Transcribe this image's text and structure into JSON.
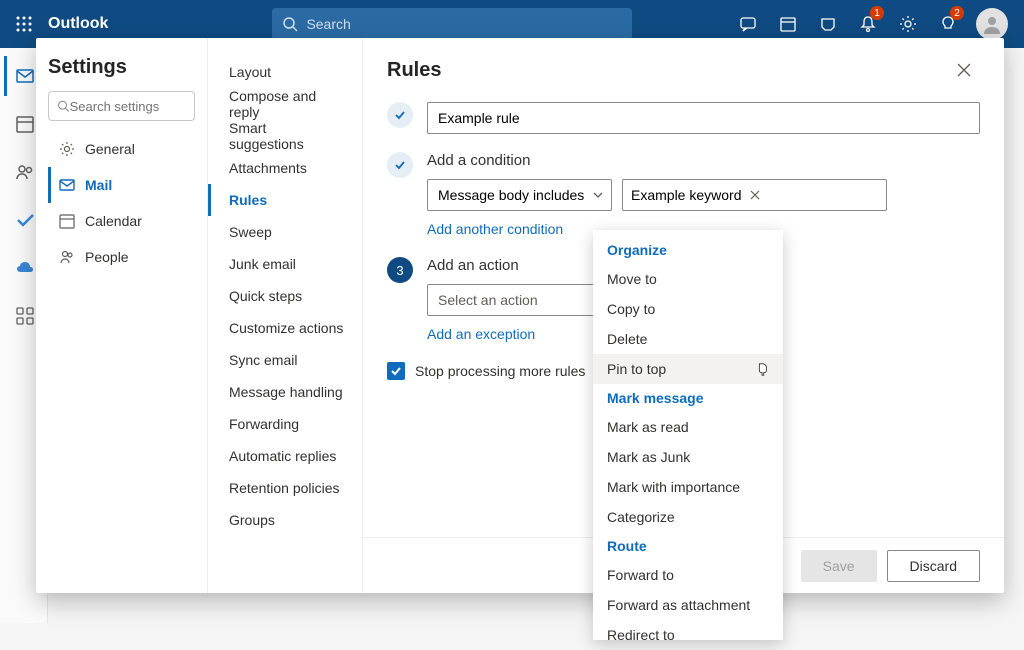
{
  "topbar": {
    "brand": "Outlook",
    "search_placeholder": "Search",
    "notif_badge": "1",
    "help_badge": "2"
  },
  "settings": {
    "title": "Settings",
    "search_placeholder": "Search settings",
    "categories": {
      "general": "General",
      "mail": "Mail",
      "calendar": "Calendar",
      "people": "People"
    },
    "mail_sub": {
      "layout": "Layout",
      "compose": "Compose and reply",
      "smart": "Smart suggestions",
      "attach": "Attachments",
      "rules": "Rules",
      "sweep": "Sweep",
      "junk": "Junk email",
      "quick": "Quick steps",
      "custom": "Customize actions",
      "sync": "Sync email",
      "msgh": "Message handling",
      "fwd": "Forwarding",
      "auto": "Automatic replies",
      "ret": "Retention policies",
      "groups": "Groups"
    }
  },
  "rules": {
    "title": "Rules",
    "name_value": "Example rule",
    "cond_label": "Add a condition",
    "cond_select": "Message body includes",
    "cond_keyword": "Example keyword",
    "add_cond": "Add another condition",
    "step3": "3",
    "action_label": "Add an action",
    "action_placeholder": "Select an action",
    "add_exc": "Add an exception",
    "stop_label": "Stop processing more rules",
    "save": "Save",
    "discard": "Discard"
  },
  "menu": {
    "hdr1": "Organize",
    "move": "Move to",
    "copy": "Copy to",
    "delete": "Delete",
    "pin": "Pin to top",
    "hdr2": "Mark message",
    "read": "Mark as read",
    "junk": "Mark as Junk",
    "imp": "Mark with importance",
    "cat": "Categorize",
    "hdr3": "Route",
    "fwdto": "Forward to",
    "fwdatt": "Forward as attachment",
    "redir": "Redirect to"
  }
}
